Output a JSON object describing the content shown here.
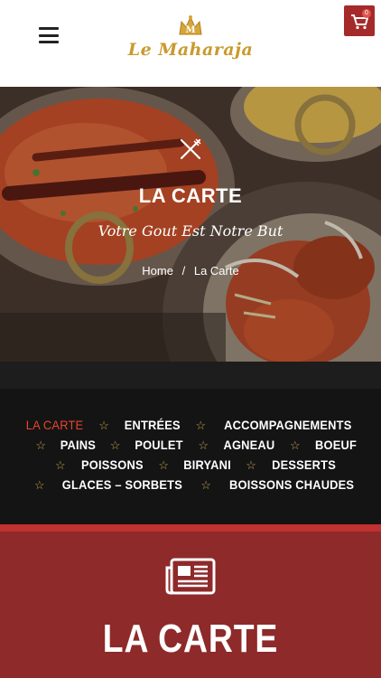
{
  "header": {
    "logo_text": "Le Maharaja",
    "logo_sub": "",
    "cart_count": "0",
    "icons": {
      "menu": "hamburger-icon",
      "cart": "cart-icon",
      "crown": "crown-icon"
    }
  },
  "hero": {
    "title": "LA CARTE",
    "subtitle": "Votre Gout Est Notre But",
    "breadcrumb": {
      "home": "Home",
      "separator": "/",
      "current": "La Carte"
    },
    "icon": "utensils-icon"
  },
  "categories": {
    "rows": [
      [
        "LA CARTE",
        "ENTRÉES",
        "ACCOMPAGNEMENTS"
      ],
      [
        "PAINS",
        "POULET",
        "AGNEAU",
        "BOEUF"
      ],
      [
        "POISSONS",
        "BIRYANI",
        "DESSERTS"
      ],
      [
        "GLACES – SORBETS",
        "BOISSONS CHAUDES"
      ]
    ],
    "active": "LA CARTE"
  },
  "section": {
    "title": "LA CARTE",
    "icon": "newspaper-icon"
  },
  "colors": {
    "accent_red": "#a52a2a",
    "gold": "#c99a2e",
    "section_bg": "#8e2a2a",
    "active_category": "#e8452e"
  }
}
